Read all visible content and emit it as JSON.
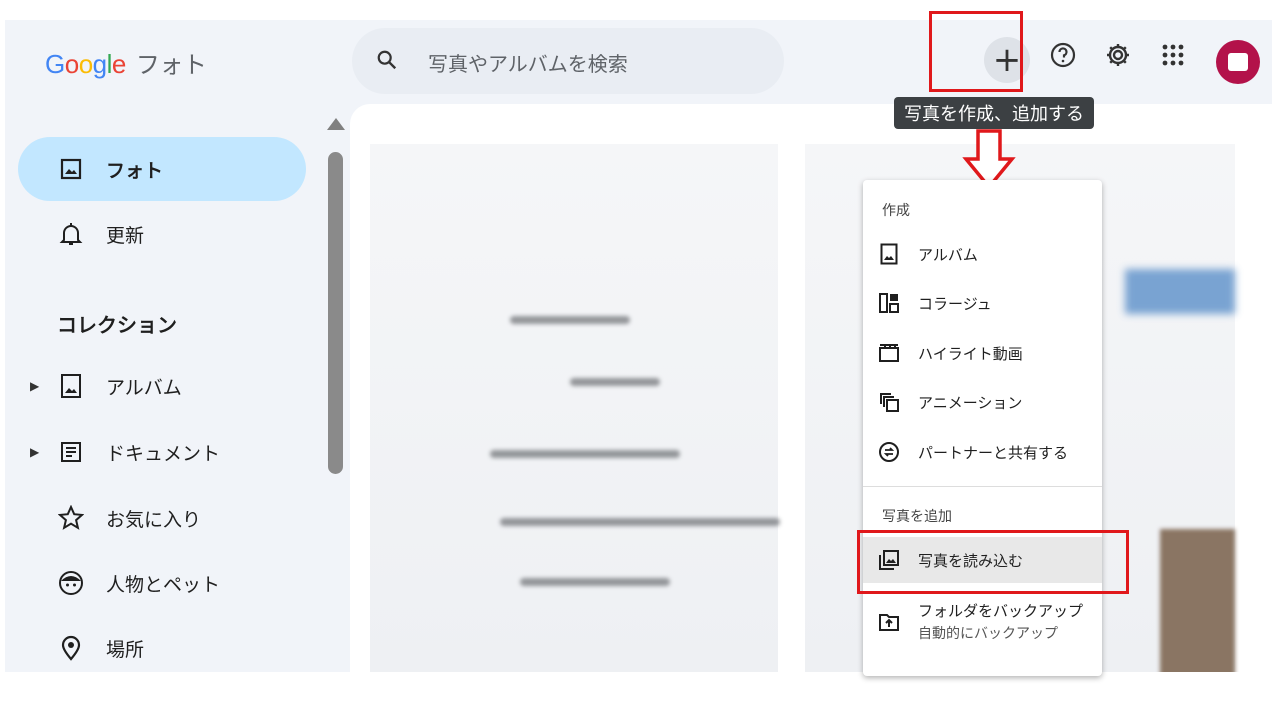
{
  "app": {
    "logo_parts": [
      "G",
      "o",
      "o",
      "g",
      "l",
      "e"
    ],
    "product": "フォト"
  },
  "search": {
    "placeholder": "写真やアルバムを検索"
  },
  "toolbar": {
    "add_label": "+",
    "tooltip": "写真を作成、追加する",
    "icons": [
      "plus-icon",
      "help-icon",
      "gear-icon",
      "apps-grid-icon",
      "avatar"
    ],
    "avatar_color": "#b3124a"
  },
  "sidebar": {
    "items": [
      {
        "label": "フォト",
        "icon": "photo-icon",
        "active": true
      },
      {
        "label": "更新",
        "icon": "bell-icon"
      }
    ],
    "collection_heading": "コレクション",
    "collection_items": [
      {
        "label": "アルバム",
        "icon": "album-icon",
        "expandable": true
      },
      {
        "label": "ドキュメント",
        "icon": "document-icon",
        "expandable": true
      },
      {
        "label": "お気に入り",
        "icon": "star-icon"
      },
      {
        "label": "人物とペット",
        "icon": "face-icon"
      },
      {
        "label": "場所",
        "icon": "location-icon"
      }
    ]
  },
  "menu": {
    "create_heading": "作成",
    "create_items": [
      {
        "label": "アルバム",
        "icon": "album-icon"
      },
      {
        "label": "コラージュ",
        "icon": "collage-icon"
      },
      {
        "label": "ハイライト動画",
        "icon": "movie-icon"
      },
      {
        "label": "アニメーション",
        "icon": "animation-icon"
      },
      {
        "label": "パートナーと共有する",
        "icon": "partner-share-icon"
      }
    ],
    "add_heading": "写真を追加",
    "import_label": "写真を読み込む",
    "backup_label": "フォルダをバックアップ",
    "backup_sub": "自動的にバックアップ"
  },
  "colors": {
    "accent": "#c2e7ff",
    "highlight": "#e0181b",
    "background": "#f1f4f9"
  }
}
